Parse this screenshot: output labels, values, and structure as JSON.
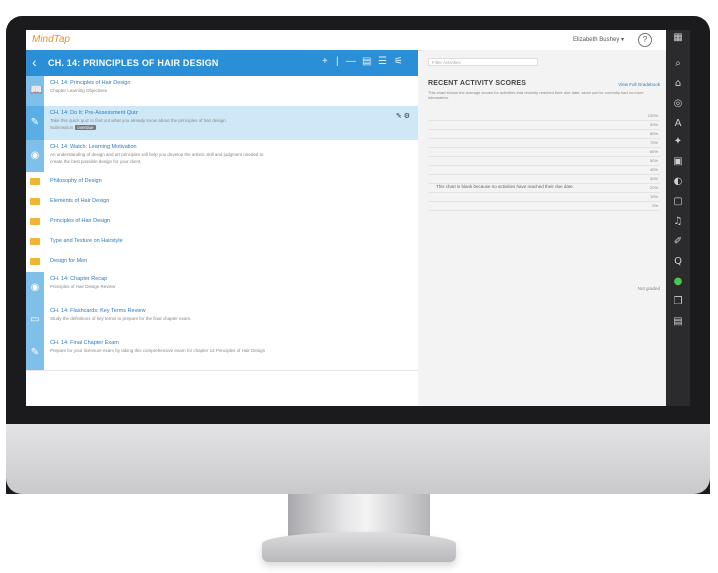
{
  "topbar": {
    "brand": "MindTap",
    "user": "Elizabeth Bushey ▾",
    "help": "?"
  },
  "chapter": {
    "back": "‹",
    "title": "CH. 14: PRINCIPLES OF HAIR DESIGN",
    "toolbar": [
      "+",
      "|",
      "—",
      "▤",
      "☰",
      "⚟"
    ]
  },
  "items": [
    {
      "kind": "activity",
      "icon": "book-icon",
      "glyph": "📖",
      "title": "CH. 14: Principles of Hair Design",
      "line2": "Chapter Learning Objectives",
      "line3": "",
      "selected": false
    },
    {
      "kind": "activity",
      "icon": "quiz-icon",
      "glyph": "✎",
      "title": "CH. 14: Do It: Pre-Assessment Quiz",
      "line2": "Take this quick quiz to find out what you already know about the principles of hair design.",
      "line3": "Submission",
      "badge": "overdue",
      "selected": true
    },
    {
      "kind": "activity",
      "icon": "play-icon",
      "glyph": "◉",
      "title": "CH. 14: Watch: Learning Motivation",
      "line2": "An understanding of design and art principles will help you develop the artistic skill and judgment needed to",
      "line3": "create the best possible design for your client.",
      "selected": false
    },
    {
      "kind": "folder",
      "title": "Philosophy of Design"
    },
    {
      "kind": "folder",
      "title": "Elements of Hair Design"
    },
    {
      "kind": "folder",
      "title": "Principles of Hair Design"
    },
    {
      "kind": "folder",
      "title": "Type and Texture on Hairstyle"
    },
    {
      "kind": "folder",
      "title": "Design for Men"
    },
    {
      "kind": "activity",
      "icon": "play-icon",
      "glyph": "◉",
      "title": "CH. 14: Chapter Recap",
      "line2": "Principles of Hair Design Review",
      "line3": "",
      "selected": false
    },
    {
      "kind": "activity",
      "icon": "flashcard-icon",
      "glyph": "▭",
      "title": "CH. 14: Flashcards: Key Terms Review",
      "line2": "Study the definitions of key terms to prepare for the final chapter exam.",
      "line3": "",
      "selected": false
    },
    {
      "kind": "activity",
      "icon": "exam-icon",
      "glyph": "✎",
      "title": "CH. 14: Final Chapter Exam",
      "line2": "Prepare for your licensure exam by taking this comprehensive exam for chapter 14 Principles of Hair Design",
      "line3": "",
      "selected": false
    }
  ],
  "activity": {
    "filter_placeholder": "Filter Activities",
    "title": "RECENT ACTIVITY SCORES",
    "link": "View Full Gradebook",
    "description": "This chart shows the average scores for activities that recently reached their due date, since you've currently had no more information.",
    "note": "This chart is blank because no activities have reached their due date.",
    "scores": [
      "100%",
      "90%",
      "80%",
      "70%",
      "60%",
      "50%",
      "40%",
      "30%",
      "20%",
      "10%",
      "0%"
    ],
    "not_graded": "Not graded"
  },
  "dock": [
    {
      "name": "search-icon",
      "glyph": "⌕"
    },
    {
      "name": "rss-icon",
      "glyph": "⌂"
    },
    {
      "name": "glossary-icon",
      "glyph": "◎"
    },
    {
      "name": "font-size-icon",
      "glyph": "A"
    },
    {
      "name": "gear-icon",
      "glyph": "✦"
    },
    {
      "name": "notebook-icon",
      "glyph": "▣"
    },
    {
      "name": "bookmark-icon",
      "glyph": "◐"
    },
    {
      "name": "flashcards-icon",
      "glyph": "▢"
    },
    {
      "name": "audio-icon",
      "glyph": "♫"
    },
    {
      "name": "pencil-icon",
      "glyph": "✐"
    },
    {
      "name": "quiz-dock-icon",
      "glyph": "Q"
    },
    {
      "name": "green-app-icon",
      "glyph": "●"
    },
    {
      "name": "copy-icon",
      "glyph": "❐"
    },
    {
      "name": "drive-icon",
      "glyph": "▤"
    }
  ]
}
